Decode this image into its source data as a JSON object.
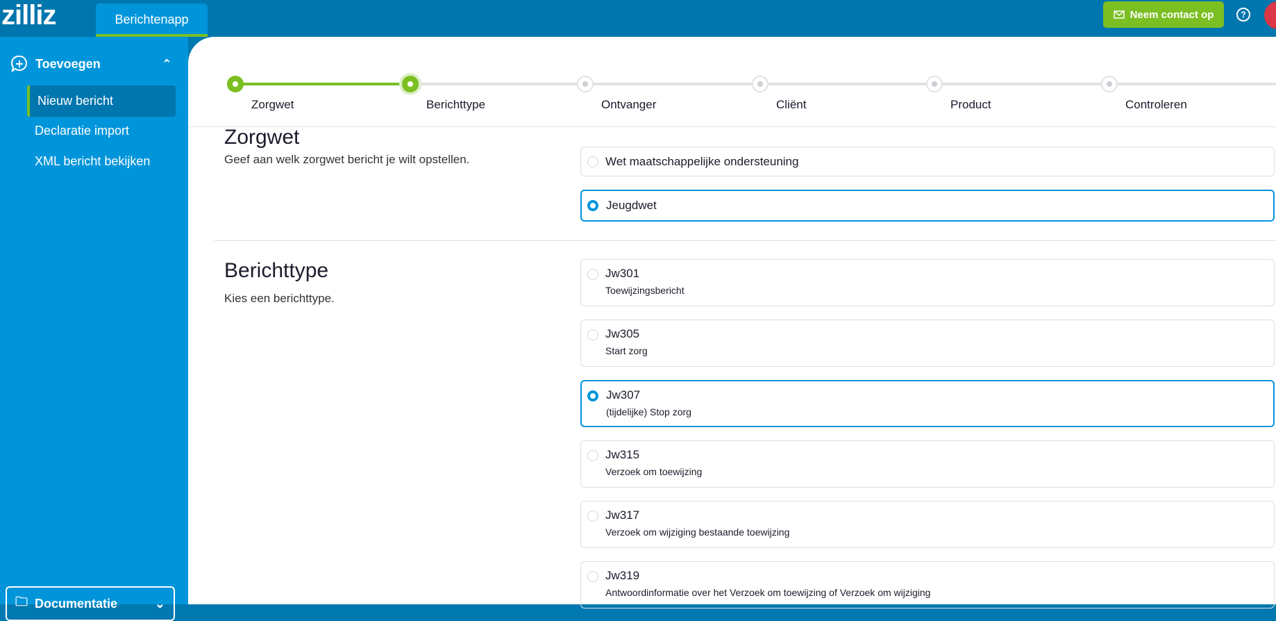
{
  "header": {
    "logo": "zilliz",
    "app_tab": "Berichtenapp",
    "contact_label": "Neem contact op",
    "help": "?",
    "colors": {
      "bar": "#0076ae",
      "accent": "#7bbf22",
      "avatar": "#dc3545"
    }
  },
  "sidebar": {
    "section": "Toevoegen",
    "items": [
      {
        "label": "Nieuw bericht",
        "active": true
      },
      {
        "label": "Declaratie import"
      },
      {
        "label": "XML bericht bekijken"
      }
    ],
    "footer": "Documentatie"
  },
  "stepper": [
    {
      "label": "Zorgwet",
      "state": "done"
    },
    {
      "label": "Berichttype",
      "state": "current"
    },
    {
      "label": "Ontvanger",
      "state": "todo"
    },
    {
      "label": "Cliënt",
      "state": "todo"
    },
    {
      "label": "Product",
      "state": "todo"
    },
    {
      "label": "Controleren",
      "state": "todo"
    }
  ],
  "zorgwet": {
    "title": "Zorgwet",
    "desc": "Geef aan welk zorgwet bericht je wilt opstellen.",
    "options": [
      {
        "label": "Wet maatschappelijke ondersteuning",
        "selected": false
      },
      {
        "label": "Jeugdwet",
        "selected": true
      }
    ]
  },
  "berichttype": {
    "title": "Berichttype",
    "desc": "Kies een berichttype.",
    "options": [
      {
        "code": "Jw301",
        "label": "Toewijzingsbericht",
        "selected": false
      },
      {
        "code": "Jw305",
        "label": "Start zorg",
        "selected": false
      },
      {
        "code": "Jw307",
        "label": "(tijdelijke) Stop zorg",
        "selected": true
      },
      {
        "code": "Jw315",
        "label": "Verzoek om toewijzing",
        "selected": false
      },
      {
        "code": "Jw317",
        "label": "Verzoek om wijziging bestaande toewijzing",
        "selected": false
      },
      {
        "code": "Jw319",
        "label": "Antwoordinformatie over het Verzoek om toewijzing of Verzoek om wijziging",
        "selected": false
      }
    ]
  }
}
